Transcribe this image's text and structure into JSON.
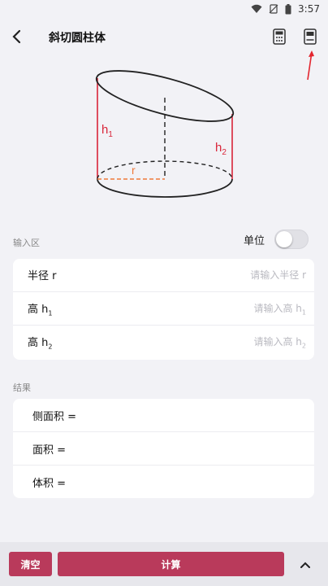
{
  "status_bar": {
    "time": "3:57"
  },
  "app_bar": {
    "title": "斜切圆柱体"
  },
  "figure": {
    "label_h1": "h",
    "label_h1_sub": "1",
    "label_h2": "h",
    "label_h2_sub": "2",
    "label_r": "r"
  },
  "input_section": {
    "label": "输入区",
    "unit_label": "单位",
    "rows": [
      {
        "label": "半径  r",
        "label_sub": "",
        "placeholder": "请输入半径  r",
        "placeholder_sub": ""
      },
      {
        "label": "高  h",
        "label_sub": "1",
        "placeholder": "请输入高  h",
        "placeholder_sub": "1"
      },
      {
        "label": "高  h",
        "label_sub": "2",
        "placeholder": "请输入高  h",
        "placeholder_sub": "2"
      }
    ]
  },
  "result_section": {
    "label": "结果",
    "rows": [
      {
        "label": "侧面积 ="
      },
      {
        "label": "面积 ="
      },
      {
        "label": "体积 ="
      }
    ]
  },
  "bottom_bar": {
    "clear_label": "清空",
    "calc_label": "计算"
  },
  "colors": {
    "accent": "#b93a5b",
    "figure_red": "#d9263a",
    "dashed_orange": "#f07a3a"
  }
}
